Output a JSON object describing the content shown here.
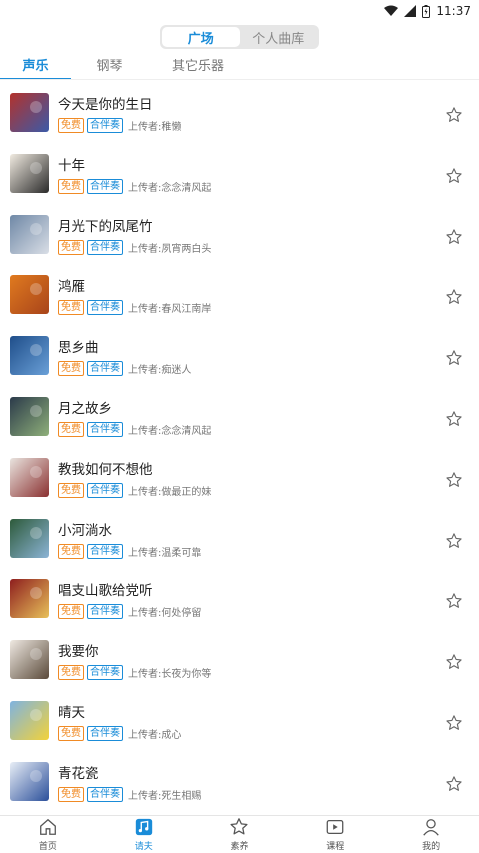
{
  "status_bar": {
    "time": "11:37"
  },
  "segment": {
    "items": [
      "广场",
      "个人曲库"
    ],
    "active": 0
  },
  "sub_tabs": [
    "声乐",
    "钢琴",
    "其它乐器"
  ],
  "songs": [
    {
      "title": "今天是你的生日",
      "free": "免费",
      "acc": "合伴奏",
      "uploader": "上传者:稚懒",
      "thumb_colors": [
        "#b3322c",
        "#3b5aa8"
      ]
    },
    {
      "title": "十年",
      "free": "免费",
      "acc": "合伴奏",
      "uploader": "上传者:念念清风起",
      "thumb_colors": [
        "#f1ebe1",
        "#2a2a2a"
      ]
    },
    {
      "title": "月光下的凤尾竹",
      "free": "免费",
      "acc": "合伴奏",
      "uploader": "上传者:夙宵两白头",
      "thumb_colors": [
        "#6f88a6",
        "#d9dee6"
      ]
    },
    {
      "title": "鸿雁",
      "free": "免费",
      "acc": "合伴奏",
      "uploader": "上传者:春风江南岸",
      "thumb_colors": [
        "#e07a1f",
        "#a8441a"
      ]
    },
    {
      "title": "思乡曲",
      "free": "免费",
      "acc": "合伴奏",
      "uploader": "上传者:痴迷人",
      "thumb_colors": [
        "#1f4e8a",
        "#6aa0d8"
      ]
    },
    {
      "title": "月之故乡",
      "free": "免费",
      "acc": "合伴奏",
      "uploader": "上传者:念念清风起",
      "thumb_colors": [
        "#2b3a4a",
        "#8fb07a"
      ]
    },
    {
      "title": "教我如何不想他",
      "free": "免费",
      "acc": "合伴奏",
      "uploader": "上传者:做最正的妹",
      "thumb_colors": [
        "#e9e4df",
        "#8a3030"
      ]
    },
    {
      "title": "小河淌水",
      "free": "免费",
      "acc": "合伴奏",
      "uploader": "上传者:温柔可靠",
      "thumb_colors": [
        "#2d5a3a",
        "#8cb4d6"
      ]
    },
    {
      "title": "唱支山歌给党听",
      "free": "免费",
      "acc": "合伴奏",
      "uploader": "上传者:何处停留",
      "thumb_colors": [
        "#8e1e1e",
        "#e8c15a"
      ]
    },
    {
      "title": "我要你",
      "free": "免费",
      "acc": "合伴奏",
      "uploader": "上传者:长夜为你等",
      "thumb_colors": [
        "#efe9e2",
        "#5a4a3a"
      ]
    },
    {
      "title": "晴天",
      "free": "免费",
      "acc": "合伴奏",
      "uploader": "上传者:成心",
      "thumb_colors": [
        "#7fb3e0",
        "#f2d23a"
      ]
    },
    {
      "title": "青花瓷",
      "free": "免费",
      "acc": "合伴奏",
      "uploader": "上传者:死生相赐",
      "thumb_colors": [
        "#e8eef6",
        "#2b4f9a"
      ]
    }
  ],
  "bottom_nav": [
    {
      "label": "首页",
      "icon": "home-icon"
    },
    {
      "label": "请夫",
      "icon": "music-note-icon"
    },
    {
      "label": "素养",
      "icon": "star-badge-icon"
    },
    {
      "label": "课程",
      "icon": "video-play-icon"
    },
    {
      "label": "我的",
      "icon": "user-icon"
    }
  ],
  "colors": {
    "accent": "#1a8cd8",
    "free_tag": "#f08a24"
  }
}
